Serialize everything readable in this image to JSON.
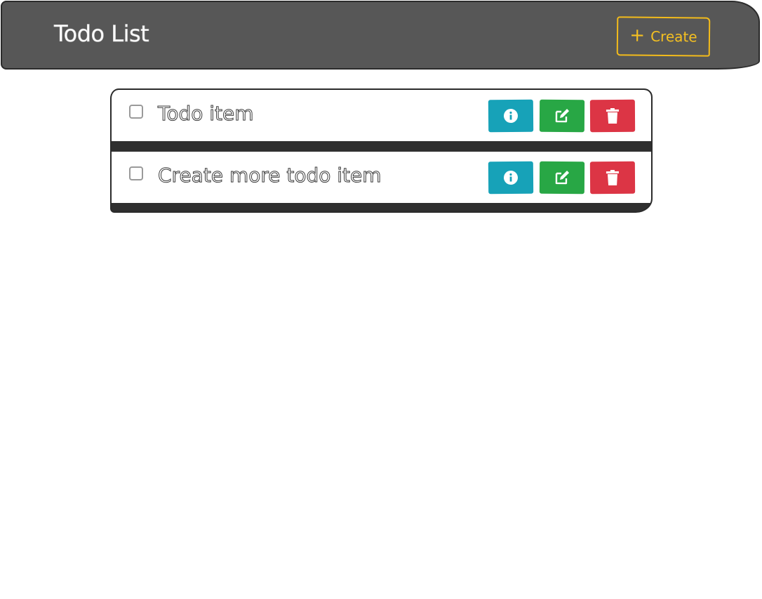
{
  "header": {
    "title": "Todo List",
    "create_label": "Create",
    "create_icon": "plus-icon"
  },
  "todos": [
    {
      "text": "Todo item",
      "checked": false
    },
    {
      "text": "Create more todo item",
      "checked": false
    }
  ],
  "actions": {
    "info_icon": "info-icon",
    "edit_icon": "edit-icon",
    "delete_icon": "trash-icon"
  },
  "colors": {
    "header_bg": "#575757",
    "accent": "#f5c021",
    "info": "#17a2b8",
    "edit": "#28a745",
    "delete": "#dc3545"
  }
}
